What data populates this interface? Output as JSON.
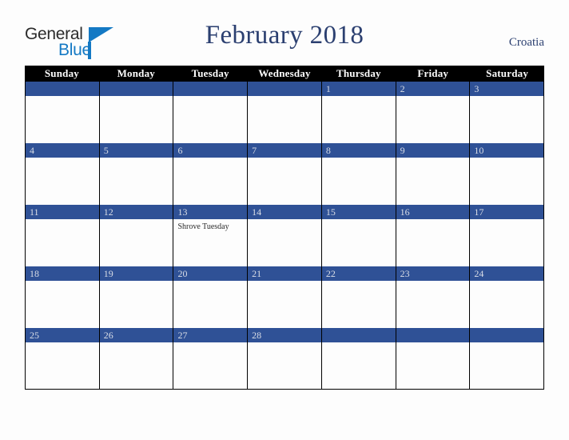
{
  "brand": {
    "name_part1": "General",
    "name_part2": "Blue",
    "accent_color": "#1479c4",
    "triangle_icon": "triangle-icon"
  },
  "header": {
    "title": "February 2018",
    "country": "Croatia",
    "title_color": "#2b3f70"
  },
  "calendar": {
    "header_bg": "#000000",
    "daybar_bg": "#2f5196",
    "daynum_color": "#d9dde6",
    "weekdays": [
      "Sunday",
      "Monday",
      "Tuesday",
      "Wednesday",
      "Thursday",
      "Friday",
      "Saturday"
    ],
    "weeks": [
      [
        {
          "day": "",
          "events": []
        },
        {
          "day": "",
          "events": []
        },
        {
          "day": "",
          "events": []
        },
        {
          "day": "",
          "events": []
        },
        {
          "day": "1",
          "events": []
        },
        {
          "day": "2",
          "events": []
        },
        {
          "day": "3",
          "events": []
        }
      ],
      [
        {
          "day": "4",
          "events": []
        },
        {
          "day": "5",
          "events": []
        },
        {
          "day": "6",
          "events": []
        },
        {
          "day": "7",
          "events": []
        },
        {
          "day": "8",
          "events": []
        },
        {
          "day": "9",
          "events": []
        },
        {
          "day": "10",
          "events": []
        }
      ],
      [
        {
          "day": "11",
          "events": []
        },
        {
          "day": "12",
          "events": []
        },
        {
          "day": "13",
          "events": [
            "Shrove Tuesday"
          ]
        },
        {
          "day": "14",
          "events": []
        },
        {
          "day": "15",
          "events": []
        },
        {
          "day": "16",
          "events": []
        },
        {
          "day": "17",
          "events": []
        }
      ],
      [
        {
          "day": "18",
          "events": []
        },
        {
          "day": "19",
          "events": []
        },
        {
          "day": "20",
          "events": []
        },
        {
          "day": "21",
          "events": []
        },
        {
          "day": "22",
          "events": []
        },
        {
          "day": "23",
          "events": []
        },
        {
          "day": "24",
          "events": []
        }
      ],
      [
        {
          "day": "25",
          "events": []
        },
        {
          "day": "26",
          "events": []
        },
        {
          "day": "27",
          "events": []
        },
        {
          "day": "28",
          "events": []
        },
        {
          "day": "",
          "events": []
        },
        {
          "day": "",
          "events": []
        },
        {
          "day": "",
          "events": []
        }
      ]
    ]
  }
}
